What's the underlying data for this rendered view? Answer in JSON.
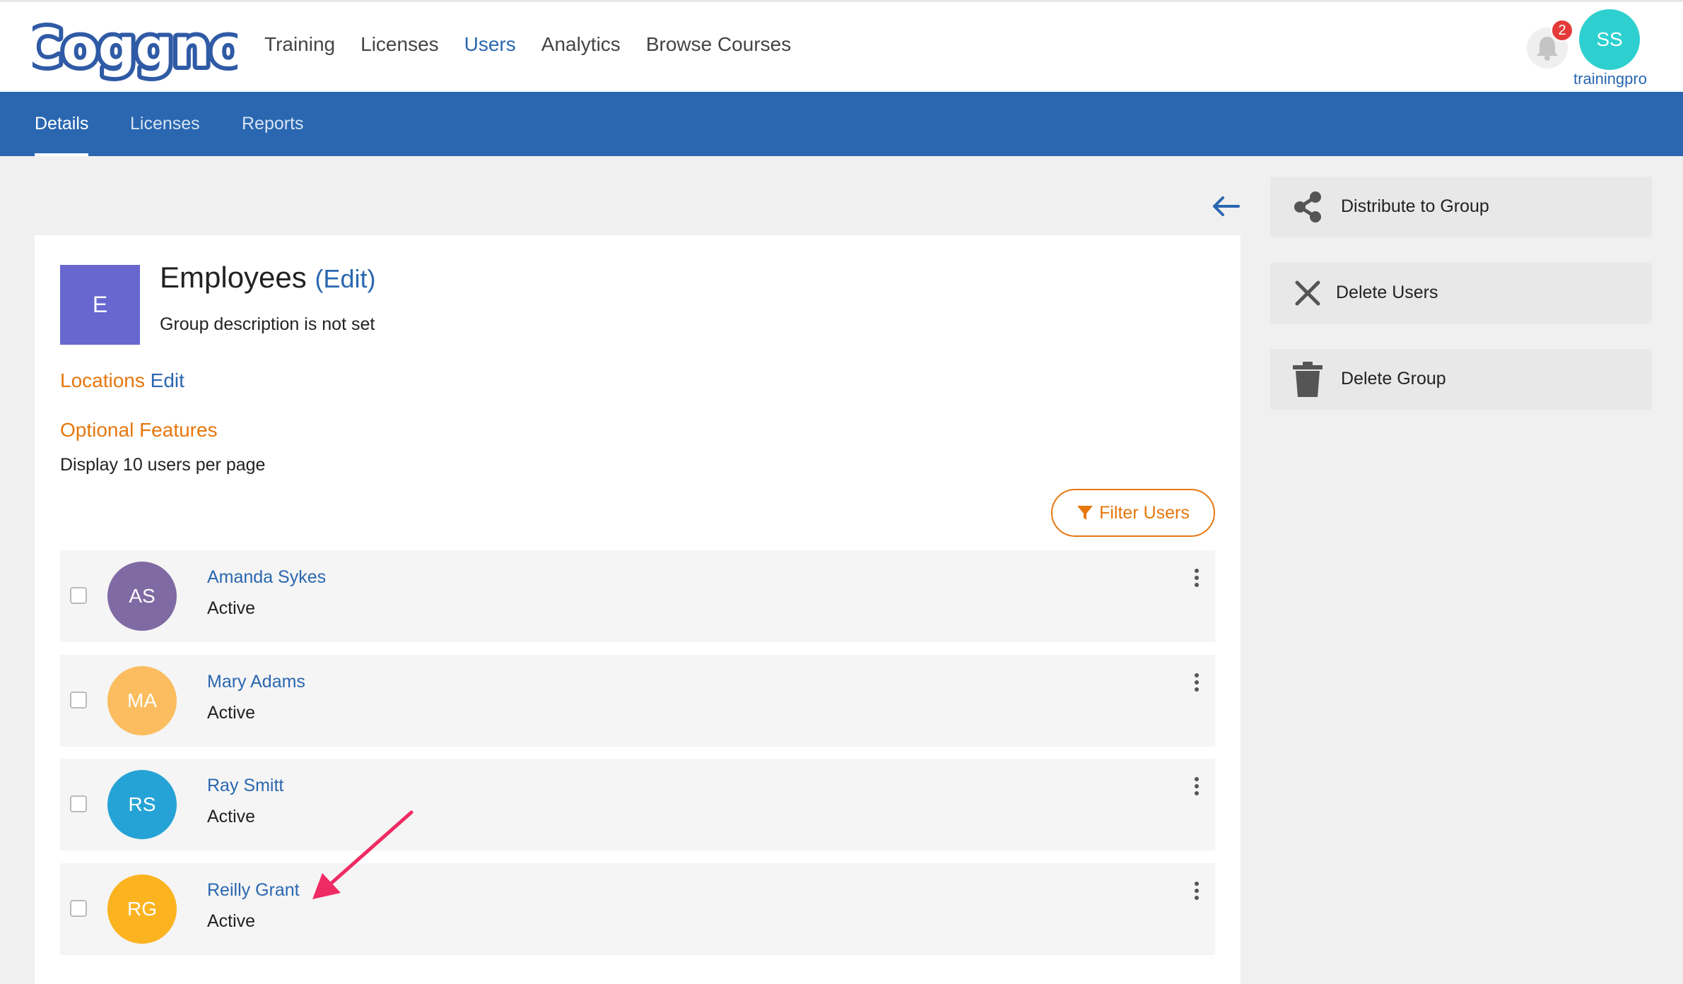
{
  "header": {
    "logo_text": "Coggno",
    "nav": [
      {
        "label": "Training",
        "active": false
      },
      {
        "label": "Licenses",
        "active": false
      },
      {
        "label": "Users",
        "active": true
      },
      {
        "label": "Analytics",
        "active": false
      },
      {
        "label": "Browse Courses",
        "active": false
      }
    ],
    "notification_count": "2",
    "user_initials": "SS",
    "user_name": "trainingpro"
  },
  "subnav": {
    "tabs": [
      {
        "label": "Details",
        "active": true
      },
      {
        "label": "Licenses",
        "active": false
      },
      {
        "label": "Reports",
        "active": false
      }
    ]
  },
  "group": {
    "initial": "E",
    "name": "Employees",
    "edit_label": "(Edit)",
    "description": "Group description is not set",
    "locations_label": "Locations",
    "locations_edit": "Edit",
    "optional_features_label": "Optional Features",
    "per_page_text": "Display 10 users per page"
  },
  "filter_button": {
    "label": "Filter Users"
  },
  "users": [
    {
      "initials": "AS",
      "name": "Amanda Sykes",
      "status": "Active",
      "color": "#7f6aa3"
    },
    {
      "initials": "MA",
      "name": "Mary Adams",
      "status": "Active",
      "color": "#fbbd5f"
    },
    {
      "initials": "RS",
      "name": "Ray Smitt",
      "status": "Active",
      "color": "#26a3d6"
    },
    {
      "initials": "RG",
      "name": "Reilly Grant",
      "status": "Active",
      "color": "#fbb320"
    }
  ],
  "actions": [
    {
      "label": "Distribute to Group",
      "icon": "share-icon"
    },
    {
      "label": "Delete Users",
      "icon": "close-icon"
    },
    {
      "label": "Delete Group",
      "icon": "trash-icon"
    }
  ],
  "colors": {
    "brand_blue": "#2a67b0",
    "accent_orange": "#e6770e",
    "annotation_arrow": "#ef2b63"
  }
}
